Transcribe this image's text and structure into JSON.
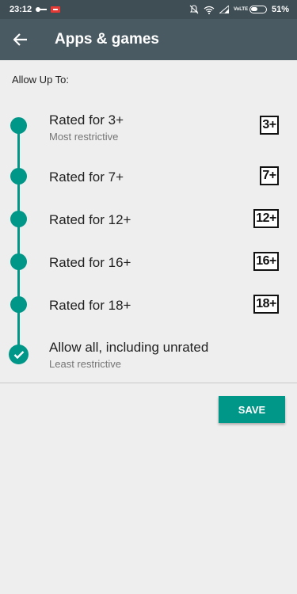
{
  "status_bar": {
    "time": "23:12",
    "volte": "VoLTE",
    "battery_percent": "51%",
    "battery_level": 0.51,
    "icons": [
      "key-icon",
      "notification-icon",
      "bell-off-icon",
      "wifi-icon",
      "signal-icon",
      "battery-icon"
    ]
  },
  "app_bar": {
    "back_icon": "arrow-back-icon",
    "title": "Apps & games"
  },
  "allow_label": "Allow Up To:",
  "options": [
    {
      "title": "Rated for 3+",
      "subtitle": "Most restrictive",
      "badge": "3+",
      "marker": "dot"
    },
    {
      "title": "Rated for 7+",
      "subtitle": "",
      "badge": "7+",
      "marker": "dot"
    },
    {
      "title": "Rated for 12+",
      "subtitle": "",
      "badge": "12+",
      "marker": "dot"
    },
    {
      "title": "Rated for 16+",
      "subtitle": "",
      "badge": "16+",
      "marker": "dot"
    },
    {
      "title": "Rated for 18+",
      "subtitle": "",
      "badge": "18+",
      "marker": "dot"
    },
    {
      "title": "Allow all, including unrated",
      "subtitle": "Least restrictive",
      "badge": "",
      "marker": "check",
      "selected": true
    }
  ],
  "save_label": "SAVE",
  "colors": {
    "accent": "#009688",
    "app_bar": "#4a5a62",
    "status_bar": "#3f4e55",
    "background": "#eeeeee"
  }
}
